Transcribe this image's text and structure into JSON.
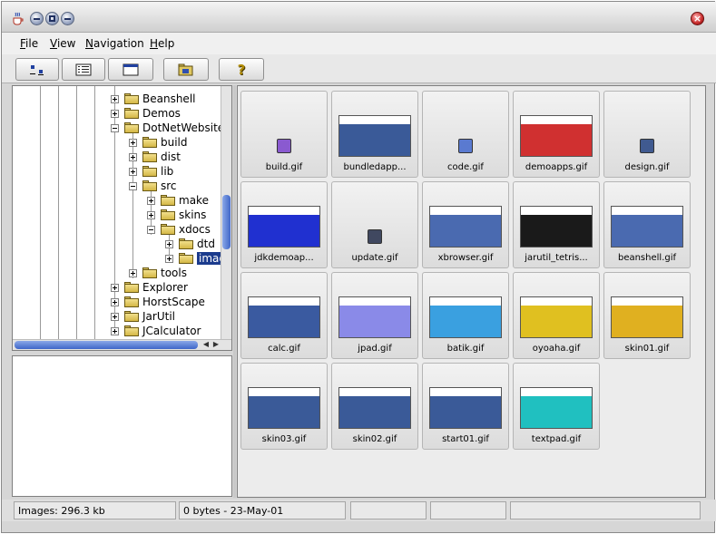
{
  "menu": {
    "file": {
      "mn": "F",
      "rest": "ile"
    },
    "view": {
      "mn": "V",
      "rest": "iew"
    },
    "navigation": {
      "mn": "N",
      "rest": "avigation"
    },
    "help": {
      "mn": "H",
      "rest": "elp"
    }
  },
  "toolbar": {
    "buttons": [
      {
        "icon": "large-icons-view-icon"
      },
      {
        "icon": "details-view-icon"
      },
      {
        "icon": "window-view-icon"
      },
      {
        "icon": "open-folder-icon"
      },
      {
        "icon": "help-question-icon"
      }
    ]
  },
  "tree": {
    "items": [
      {
        "label": "Beanshell",
        "state": "collapsed",
        "level": 0
      },
      {
        "label": "Demos",
        "state": "collapsed",
        "level": 0
      },
      {
        "label": "DotNetWebsite",
        "state": "expanded",
        "level": 0
      },
      {
        "label": "build",
        "state": "collapsed",
        "level": 1
      },
      {
        "label": "dist",
        "state": "collapsed",
        "level": 1
      },
      {
        "label": "lib",
        "state": "collapsed",
        "level": 1
      },
      {
        "label": "src",
        "state": "expanded",
        "level": 1
      },
      {
        "label": "make",
        "state": "collapsed",
        "level": 2
      },
      {
        "label": "skins",
        "state": "collapsed",
        "level": 2
      },
      {
        "label": "xdocs",
        "state": "expanded",
        "level": 2
      },
      {
        "label": "dtd",
        "state": "collapsed",
        "level": 3
      },
      {
        "label": "imag",
        "state": "collapsed",
        "level": 3,
        "selected": true
      },
      {
        "label": "tools",
        "state": "collapsed",
        "level": 1
      },
      {
        "label": "Explorer",
        "state": "collapsed",
        "level": 0
      },
      {
        "label": "HorstScape",
        "state": "collapsed",
        "level": 0
      },
      {
        "label": "JarUtil",
        "state": "collapsed",
        "level": 0
      },
      {
        "label": "JCalculator",
        "state": "collapsed",
        "level": 0
      }
    ]
  },
  "thumbnails": [
    {
      "caption": "build.gif",
      "kind": "icon",
      "color": "#8a5ad0"
    },
    {
      "caption": "bundledapp...",
      "kind": "screenshot",
      "color": "#3a5a98"
    },
    {
      "caption": "code.gif",
      "kind": "icon",
      "color": "#5a7ad0"
    },
    {
      "caption": "demoapps.gif",
      "kind": "screenshot",
      "color": "#d03030"
    },
    {
      "caption": "design.gif",
      "kind": "icon",
      "color": "#405a90"
    },
    {
      "caption": "jdkdemoap...",
      "kind": "screenshot",
      "color": "#2030d0"
    },
    {
      "caption": "update.gif",
      "kind": "icon",
      "color": "#404860"
    },
    {
      "caption": "xbrowser.gif",
      "kind": "screenshot",
      "color": "#4a6ab0"
    },
    {
      "caption": "jarutil_tetris...",
      "kind": "screenshot",
      "color": "#1a1a1a"
    },
    {
      "caption": "beanshell.gif",
      "kind": "screenshot",
      "color": "#4a6ab0"
    },
    {
      "caption": "calc.gif",
      "kind": "screenshot",
      "color": "#3a5aa0"
    },
    {
      "caption": "jpad.gif",
      "kind": "screenshot",
      "color": "#8a8ae8"
    },
    {
      "caption": "batik.gif",
      "kind": "screenshot",
      "color": "#3aa0e0"
    },
    {
      "caption": "oyoaha.gif",
      "kind": "screenshot",
      "color": "#e0c020"
    },
    {
      "caption": "skin01.gif",
      "kind": "screenshot",
      "color": "#e0b020"
    },
    {
      "caption": "skin03.gif",
      "kind": "screenshot",
      "color": "#3a5a98"
    },
    {
      "caption": "skin02.gif",
      "kind": "screenshot",
      "color": "#3a5a98"
    },
    {
      "caption": "start01.gif",
      "kind": "screenshot",
      "color": "#3a5a98"
    },
    {
      "caption": "textpad.gif",
      "kind": "screenshot",
      "color": "#20c0c0"
    }
  ],
  "status": {
    "left": "Images: 296.3 kb",
    "middle": "0 bytes - 23-May-01",
    "c3": "",
    "c4": "",
    "c5": ""
  }
}
